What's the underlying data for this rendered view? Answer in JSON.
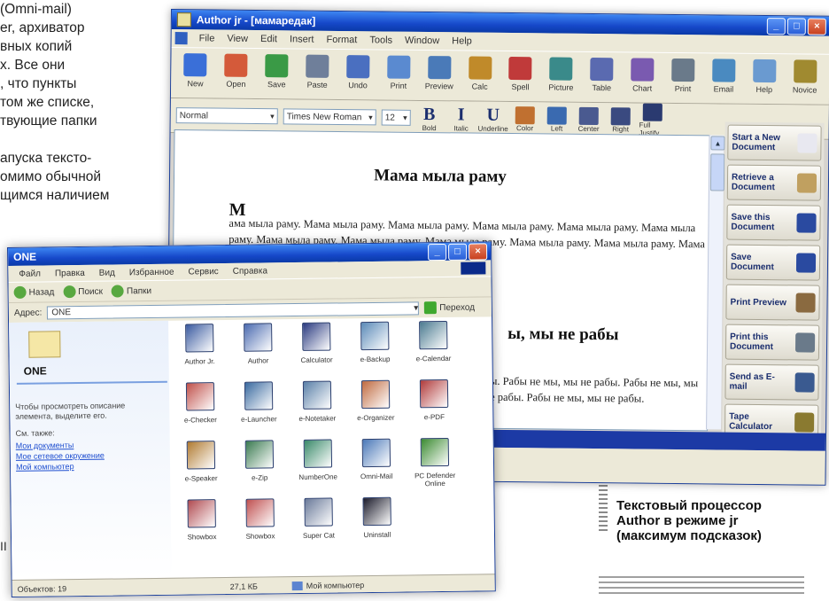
{
  "article": {
    "lines": [
      "(Omni-mail)",
      "er, архиватор",
      "вных копий",
      "х. Все они",
      ", что пункты",
      "том же списке,",
      "твующие папки",
      "",
      "апуска тексто-",
      "омимо обычной",
      "щимся наличием"
    ],
    "left_fragment": "II",
    "caption": "Текстовый процессор\nAuthor в режиме jr\n(максимум подсказок)"
  },
  "author": {
    "title": "Author jr - [мамаредак]",
    "menu": [
      "File",
      "View",
      "Edit",
      "Insert",
      "Format",
      "Tools",
      "Window",
      "Help"
    ],
    "toolbar1": [
      {
        "label": "New",
        "color": "#3a6fd8"
      },
      {
        "label": "Open",
        "color": "#d45a3a"
      },
      {
        "label": "Save",
        "color": "#3a9a46"
      },
      {
        "label": "Paste",
        "color": "#6f7f9a"
      },
      {
        "label": "Undo",
        "color": "#4a6fc0"
      },
      {
        "label": "Print",
        "color": "#5a8ad0"
      },
      {
        "label": "Preview",
        "color": "#4a7ab8"
      },
      {
        "label": "Calc",
        "color": "#c08a2a"
      },
      {
        "label": "Spell",
        "color": "#c03a3a"
      },
      {
        "label": "Picture",
        "color": "#3a8a8a"
      },
      {
        "label": "Table",
        "color": "#5a6ab0"
      },
      {
        "label": "Chart",
        "color": "#7a5ab0"
      },
      {
        "label": "Print",
        "color": "#6a7a8a"
      },
      {
        "label": "Email",
        "color": "#4a8ac0"
      },
      {
        "label": "Help",
        "color": "#6a9ad0"
      },
      {
        "label": "Novice",
        "color": "#a08a30"
      }
    ],
    "font_name": "Normal",
    "font_family": "Times New Roman",
    "font_size": "12",
    "format": [
      {
        "glyph": "B",
        "label": "Bold"
      },
      {
        "glyph": "I",
        "label": "Italic"
      },
      {
        "glyph": "U",
        "label": "Underline"
      }
    ],
    "format2": [
      {
        "label": "Color",
        "color": "#c07030"
      },
      {
        "label": "Left",
        "color": "#3a6ab0"
      },
      {
        "label": "Center",
        "color": "#4a5a90"
      },
      {
        "label": "Right",
        "color": "#3a4a80"
      },
      {
        "label": "Full Justify",
        "color": "#2a3a70"
      }
    ],
    "doc": {
      "heading": "Мама мыла раму",
      "drop_cap": "М",
      "para": "ама мыла раму. Мама мыла раму. Мама мыла раму. Мама мыла раму. Мама мыла раму. Мама мыла раму. Мама мыла раму. Мама мыла раму. Мама мыла раму. Мама мыла раму. Мама мыла раму. Мама мыла раму. Мама мыла раму.",
      "heading2": "ы, мы не рабы",
      "para2": "бы. Рабы не мы, мы не рабы. Рабы не мы, мы не рабы. Рабы не мы, мы не рабы."
    },
    "side_buttons": [
      {
        "label": "Start a New Document",
        "color": "#e8e8f0"
      },
      {
        "label": "Retrieve a Document",
        "color": "#c0a060"
      },
      {
        "label": "Save this Document",
        "color": "#2a4aa0"
      },
      {
        "label": "Save Document",
        "color": "#2a4aa0"
      },
      {
        "label": "Print Preview",
        "color": "#8a6a40"
      },
      {
        "label": "Print this Document",
        "color": "#6a7a8a"
      },
      {
        "label": "Send as E-mail",
        "color": "#3a5a90"
      },
      {
        "label": "Tape Calculator",
        "color": "#8a7a30"
      }
    ]
  },
  "explorer": {
    "title": "ONE",
    "menu": [
      "Файл",
      "Правка",
      "Вид",
      "Избранное",
      "Сервис",
      "Справка"
    ],
    "toolbar": [
      "Назад",
      "Поиск",
      "Папки"
    ],
    "address_label": "Адрес:",
    "address_value": "ONE",
    "go_label": "Переход",
    "folder_name": "ONE",
    "description": "Чтобы просмотреть описание элемента, выделите его.",
    "see_also": "См. также:",
    "links": [
      "Мои документы",
      "Мое сетевое окружение",
      "Мой компьютер"
    ],
    "icons": [
      {
        "label": "Author Jr.",
        "color": "#3a5aa0"
      },
      {
        "label": "Author",
        "color": "#4a6ab0"
      },
      {
        "label": "Calculator",
        "color": "#2a3a80"
      },
      {
        "label": "e-Backup",
        "color": "#5a8ab8"
      },
      {
        "label": "e-Calendar",
        "color": "#4a7a90"
      },
      {
        "label": "e-Checker",
        "color": "#c0504a"
      },
      {
        "label": "e-Launcher",
        "color": "#3a6aa0"
      },
      {
        "label": "e-Notetaker",
        "color": "#5a80a8"
      },
      {
        "label": "e-Organizer",
        "color": "#c06a40"
      },
      {
        "label": "e-PDF",
        "color": "#b03a3a"
      },
      {
        "label": "e-Speaker",
        "color": "#b07a30"
      },
      {
        "label": "e-Zip",
        "color": "#3a7a50"
      },
      {
        "label": "NumberOne",
        "color": "#3a8a6a"
      },
      {
        "label": "Omni-Mail",
        "color": "#4a78b8"
      },
      {
        "label": "PC Defender Online",
        "color": "#3a8a30"
      },
      {
        "label": "Showbox",
        "color": "#b04a50"
      },
      {
        "label": "Showbox",
        "color": "#c05050"
      },
      {
        "label": "Super Cat",
        "color": "#6a7a9a"
      },
      {
        "label": "Uninstall",
        "color": "#1a1a2a"
      }
    ],
    "status_objects": "Объектов: 19",
    "status_size": "27,1 КБ",
    "status_location": "Мой компьютер"
  }
}
